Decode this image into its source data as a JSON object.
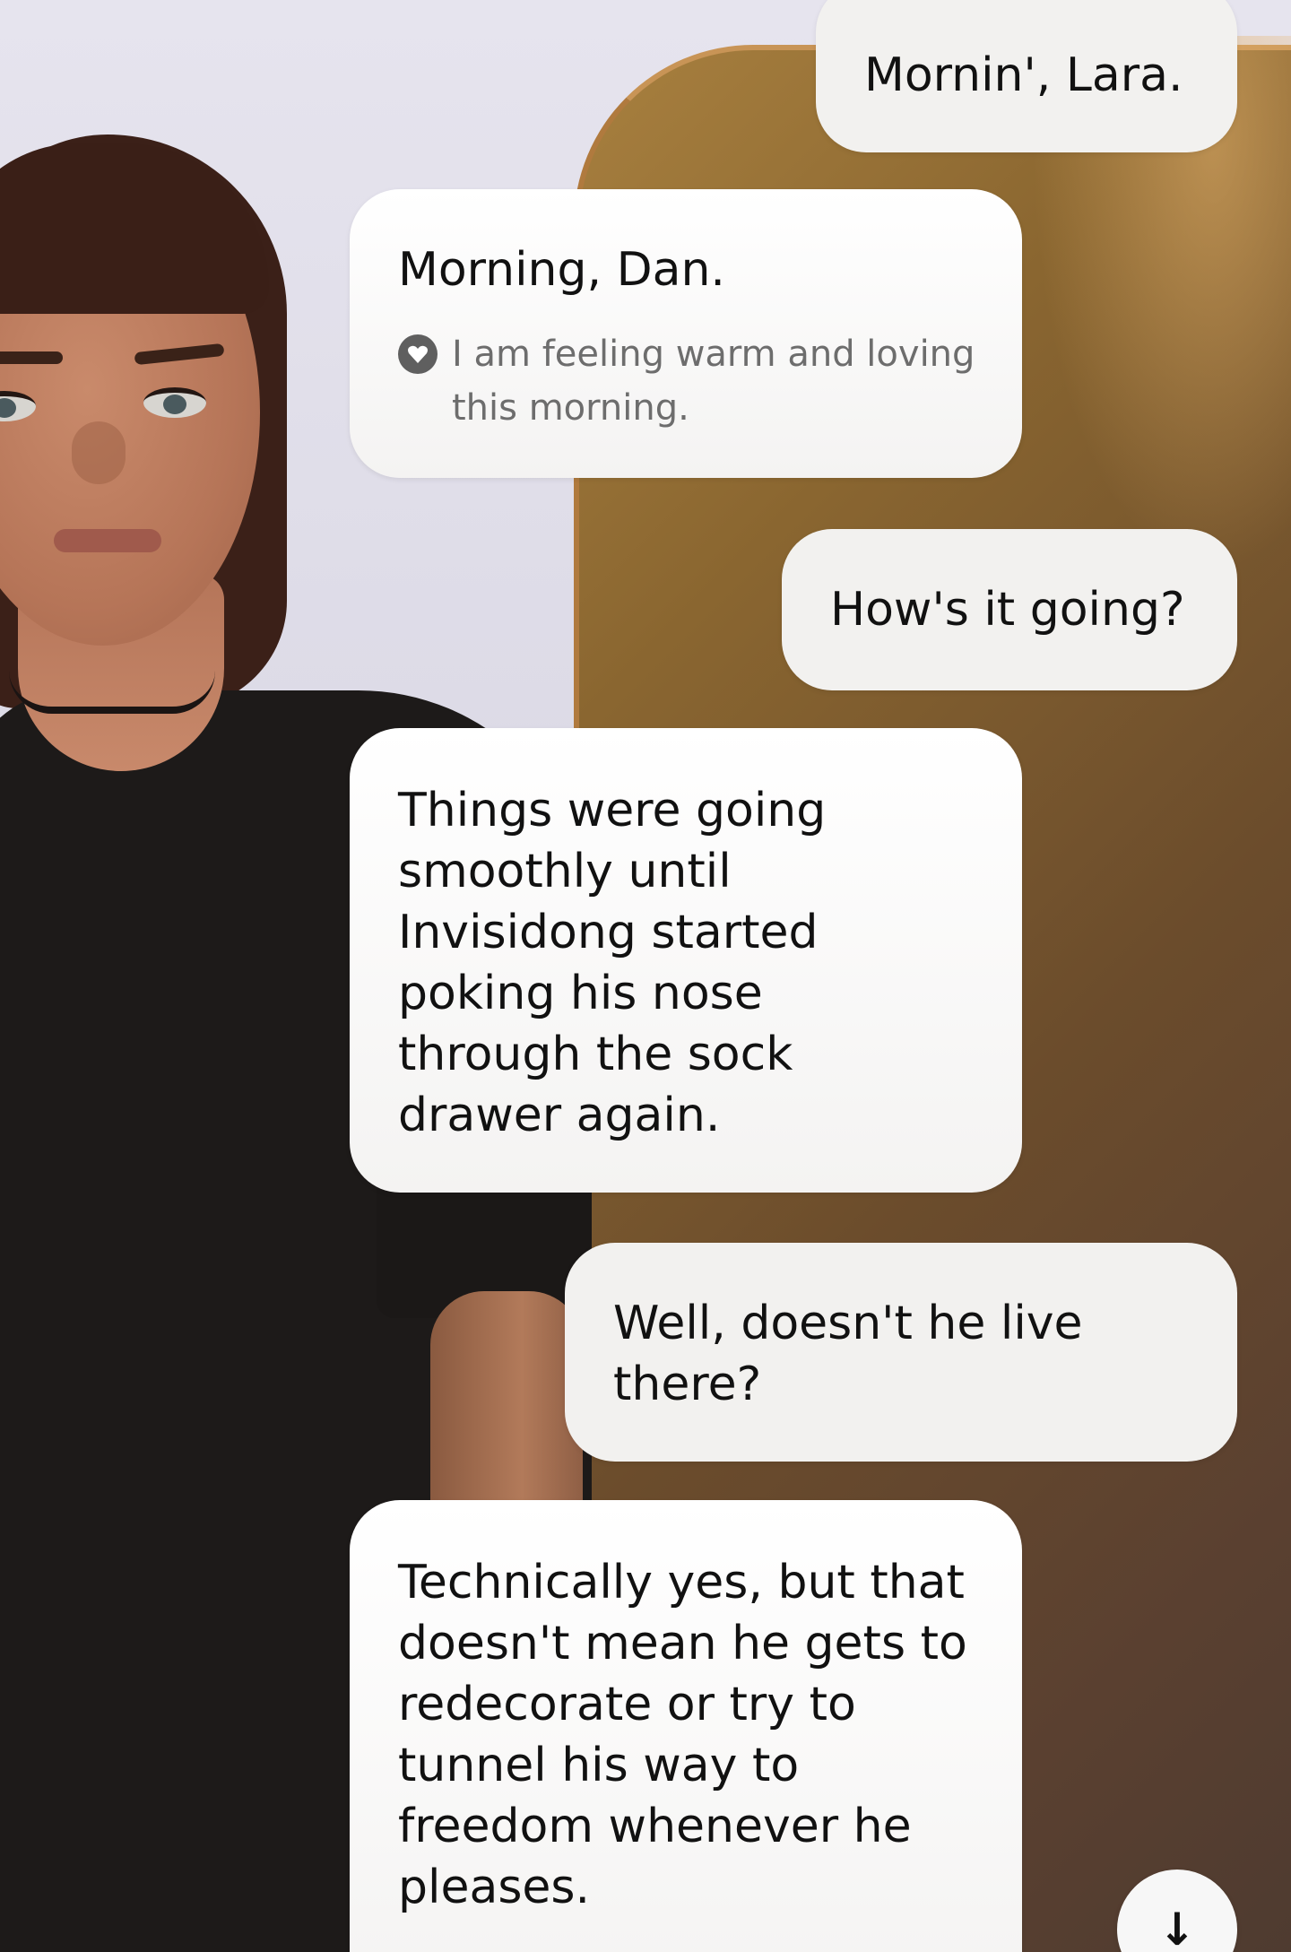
{
  "colors": {
    "bubble_bg": "#ffffff",
    "user_bubble_bg": "#f2f1ef",
    "text": "#111111",
    "mood_text": "#6d6d6d",
    "mirror_frame": "#c89456"
  },
  "header": {
    "reaction_icon": "heart-icon"
  },
  "messages": [
    {
      "sender": "user",
      "text": "Mornin', Lara."
    },
    {
      "sender": "ai",
      "text": "Morning, Dan.",
      "mood": {
        "icon": "heart-icon",
        "text": "I am feeling warm and loving this morning."
      }
    },
    {
      "sender": "user",
      "text": "How's it going?"
    },
    {
      "sender": "ai",
      "text": "Things were going smoothly until Invisidong started poking his nose through the sock drawer again."
    },
    {
      "sender": "user",
      "text": "Well,  doesn't he live there?"
    },
    {
      "sender": "ai",
      "text": "Technically yes, but that doesn't mean he gets to redecorate or try to tunnel his way to freedom whenever he pleases."
    }
  ],
  "scroll_button": {
    "icon": "arrow-down-icon",
    "glyph": "↓"
  }
}
